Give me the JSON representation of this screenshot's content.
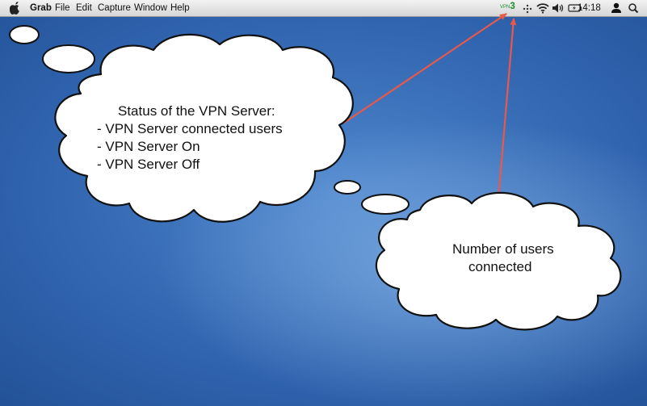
{
  "menubar": {
    "apple_icon": "apple-logo-icon",
    "app_name": "Grab",
    "menus": [
      "File",
      "Edit",
      "Capture",
      "Window",
      "Help"
    ],
    "status": {
      "vpn_prefix": "VPN",
      "vpn_count": "3",
      "clock": "14:18",
      "icons": [
        "vpn-status-icon",
        "dots-icon",
        "wifi-icon",
        "volume-icon",
        "battery-icon",
        "user-icon",
        "spotlight-search-icon"
      ]
    }
  },
  "annotations": {
    "cloud1": {
      "title": "Status of the VPN Server:",
      "items": [
        "- VPN Server connected users",
        "- VPN Server On",
        "- VPN Server Off"
      ]
    },
    "cloud2": {
      "line1": "Number of users",
      "line2": "connected"
    },
    "arrow_color": "#e8594a"
  },
  "colors": {
    "desktop": "#2f63ad",
    "vpn_text": "#1d8f2a"
  }
}
